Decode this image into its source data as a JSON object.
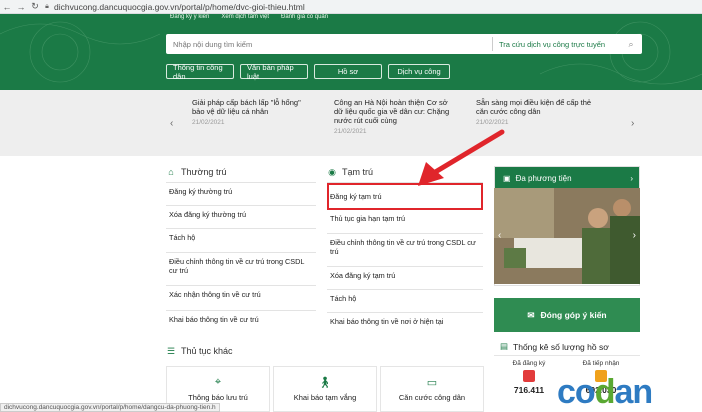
{
  "browser": {
    "url": "dichvucong.dancuquocgia.gov.vn/portal/p/home/dvc-gioi-thieu.html"
  },
  "header": {
    "top_links": [
      "Đăng ký ý kiến",
      "Xem dịch tâm việt",
      "Đánh giá có quản"
    ],
    "search_placeholder": "Nhập nội dung tìm kiếm",
    "lookup_label": "Tra cứu dịch vụ công trực tuyến",
    "quick_buttons": [
      "Thông tin công dân",
      "Văn bản pháp luật",
      "Hồ sơ",
      "Dịch vụ công"
    ]
  },
  "news": [
    {
      "title": "Giải pháp cấp bách lấp \"lỗ hổng\" bảo vệ dữ liệu cá nhân",
      "date": "21/02/2021"
    },
    {
      "title": "Công an Hà Nội hoàn thiện Cơ sở dữ liệu quốc gia về dân cư: Chặng nước rút cuối cùng",
      "date": "21/02/2021"
    },
    {
      "title": "Sẵn sàng mọi điều kiện để cấp thẻ căn cước công dân",
      "date": "21/02/2021"
    }
  ],
  "thuong_tru": {
    "title": "Thường trú",
    "links": [
      "Đăng ký thường trú",
      "Xóa đăng ký thường trú",
      "Tách hộ",
      "Điều chỉnh thông tin về cư trú trong CSDL cư trú",
      "Xác nhận thông tin về cư trú",
      "Khai báo thông tin về cư trú"
    ]
  },
  "tam_tru": {
    "title": "Tạm trú",
    "links": [
      "Đăng ký tạm trú",
      "Thủ tục gia hạn tạm trú",
      "Điều chỉnh thông tin về cư trú trong CSDL cư trú",
      "Xóa đăng ký tạm trú",
      "Tách hộ",
      "Khai báo thông tin về nơi ở hiện tại"
    ]
  },
  "media": {
    "title": "Đa phương tiện"
  },
  "feedback": {
    "label": "Đóng góp ý kiến"
  },
  "stats": {
    "title": "Thống kê số lượng hồ sơ",
    "items": [
      {
        "label": "Đã đăng ký",
        "value": "716.411"
      },
      {
        "label": "Đã tiếp nhận",
        "value": "692.030"
      }
    ]
  },
  "other_procedures": {
    "title": "Thủ tục khác",
    "cards": [
      "Thông báo lưu trú",
      "Khai báo tạm vắng",
      "Căn cước công dân"
    ]
  },
  "status_url": "dichvucong.dancuquocgia.gov.vn/portal/p/home/dangcu-da-phuong-tien.h",
  "watermark": "codan",
  "colors": {
    "primary": "#1b7a46",
    "highlight": "#e0252b",
    "watermark_blue": "#2e7bc2",
    "watermark_green": "#5aa832"
  }
}
